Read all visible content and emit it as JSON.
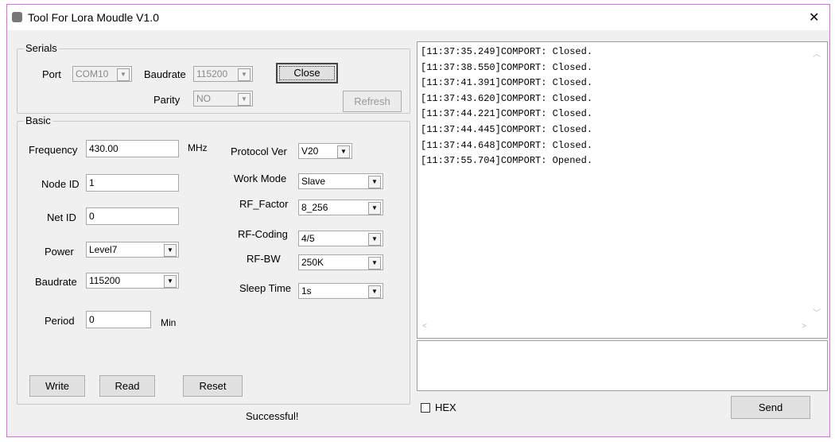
{
  "window": {
    "title": "Tool For Lora Moudle V1.0",
    "close_glyph": "✕"
  },
  "serials": {
    "group": "Serials",
    "port_label": "Port",
    "port_value": "COM10",
    "baud_label": "Baudrate",
    "baud_value": "115200",
    "parity_label": "Parity",
    "parity_value": "NO",
    "close_btn": "Close",
    "refresh_btn": "Refresh"
  },
  "basic": {
    "group": "Basic",
    "frequency_label": "Frequency",
    "frequency_value": "430.00",
    "frequency_unit": "MHz",
    "nodeid_label": "Node ID",
    "nodeid_value": "1",
    "netid_label": "Net ID",
    "netid_value": "0",
    "power_label": "Power",
    "power_value": "Level7",
    "baud_label": "Baudrate",
    "baud_value": "115200",
    "period_label": "Period",
    "period_value": "0",
    "period_unit": "Min",
    "protocol_label": "Protocol Ver",
    "protocol_value": "V20",
    "workmode_label": "Work Mode",
    "workmode_value": "Slave",
    "rffactor_label": "RF_Factor",
    "rffactor_value": "8_256",
    "rfcoding_label": "RF-Coding",
    "rfcoding_value": "4/5",
    "rfbw_label": "RF-BW",
    "rfbw_value": "250K",
    "sleep_label": "Sleep Time",
    "sleep_value": "1s",
    "write_btn": "Write",
    "read_btn": "Read",
    "reset_btn": "Reset"
  },
  "status": "Successful!",
  "log": [
    "[11:37:35.249]COMPORT: Closed.",
    "[11:37:38.550]COMPORT: Closed.",
    "[11:37:41.391]COMPORT: Closed.",
    "[11:37:43.620]COMPORT: Closed.",
    "[11:37:44.221]COMPORT: Closed.",
    "[11:37:44.445]COMPORT: Closed.",
    "[11:37:44.648]COMPORT: Closed.",
    "[11:37:55.704]COMPORT: Opened."
  ],
  "send": {
    "hex_label": "HEX",
    "send_btn": "Send",
    "input_value": ""
  }
}
